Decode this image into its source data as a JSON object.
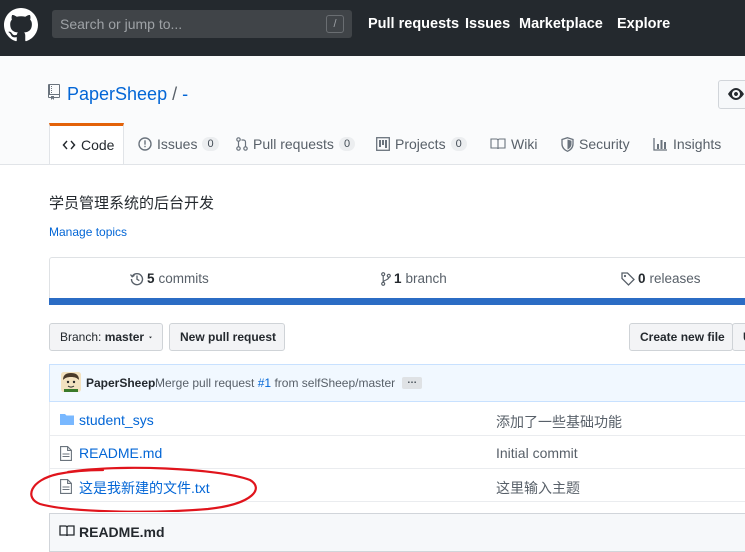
{
  "topnav": {
    "search_placeholder": "Search or jump to...",
    "search_shortcut": "/",
    "links": [
      "Pull requests",
      "Issues",
      "Marketplace",
      "Explore"
    ]
  },
  "repo": {
    "owner": "PaperSheep",
    "separator": "/",
    "name": "-"
  },
  "tabs": {
    "code": "Code",
    "issues": "Issues",
    "issues_count": "0",
    "pulls": "Pull requests",
    "pulls_count": "0",
    "projects": "Projects",
    "projects_count": "0",
    "wiki": "Wiki",
    "security": "Security",
    "insights": "Insights"
  },
  "description": "学员管理系统的后台开发",
  "manage_topics": "Manage topics",
  "summary": {
    "commits_count": "5",
    "commits_label": "commits",
    "branch_count": "1",
    "branch_label": "branch",
    "releases_count": "0",
    "releases_label": "releases"
  },
  "toolbar": {
    "branch_label": "Branch:",
    "branch_value": "master",
    "new_pr": "New pull request",
    "create_file": "Create new file",
    "upload_partial": "U"
  },
  "latest_commit": {
    "author": "PaperSheep",
    "message_prefix": "Merge pull request",
    "pr_ref": "#1",
    "message_suffix": "from selfSheep/master",
    "ellipsis": "…"
  },
  "files": [
    {
      "name": "student_sys",
      "type": "folder",
      "message": "添加了一些基础功能"
    },
    {
      "name": "README.md",
      "type": "file",
      "message": "Initial commit"
    },
    {
      "name": "这是我新建的文件.txt",
      "type": "file",
      "message": "这里输入主题"
    }
  ],
  "readme_title": "README.md",
  "colors": {
    "topbar": "#24292e",
    "link": "#0366d6",
    "tab_accent": "#e36209",
    "annotation": "#e0141c"
  }
}
